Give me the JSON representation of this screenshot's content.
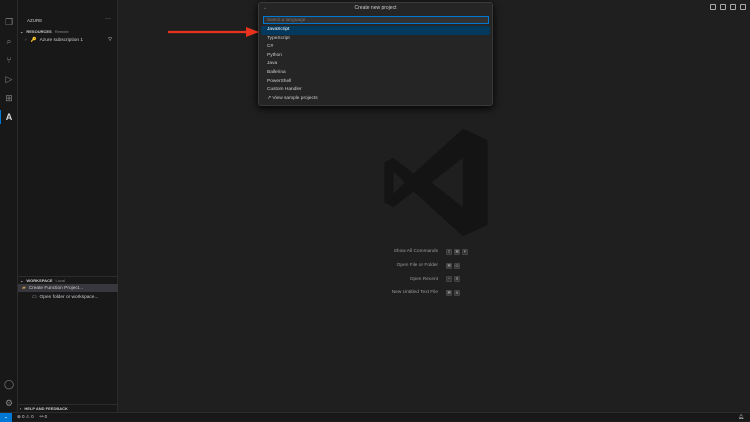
{
  "sidebar": {
    "title": "AZURE",
    "resources": {
      "label": "RESOURCES",
      "sub": "Remote",
      "items": [
        "Azure subscription 1"
      ]
    },
    "workspace": {
      "label": "WORKSPACE",
      "sub": "Local",
      "items": [
        "Create Function Project...",
        "Open folder or workspace..."
      ]
    },
    "help": "HELP AND FEEDBACK"
  },
  "palette": {
    "title": "Create new project",
    "placeholder": "Select a language",
    "items": [
      "JavaScript",
      "TypeScript",
      "C#",
      "Python",
      "Java",
      "Ballerina",
      "PowerShell",
      "Custom Handler"
    ],
    "sample": "View sample projects"
  },
  "hints": [
    {
      "label": "Show All Commands",
      "keys": [
        "⇧",
        "⌘",
        "P"
      ]
    },
    {
      "label": "Open File or Folder",
      "keys": [
        "⌘",
        "O"
      ]
    },
    {
      "label": "Open Recent",
      "keys": [
        "^",
        "R"
      ]
    },
    {
      "label": "New Untitled Text File",
      "keys": [
        "⌘",
        "N"
      ]
    }
  ],
  "status": {
    "errors": "0",
    "warnings": "0",
    "ports": "0"
  },
  "colors": {
    "accent": "#0078d4",
    "arrow": "#e8321e",
    "selection": "#04395e"
  }
}
